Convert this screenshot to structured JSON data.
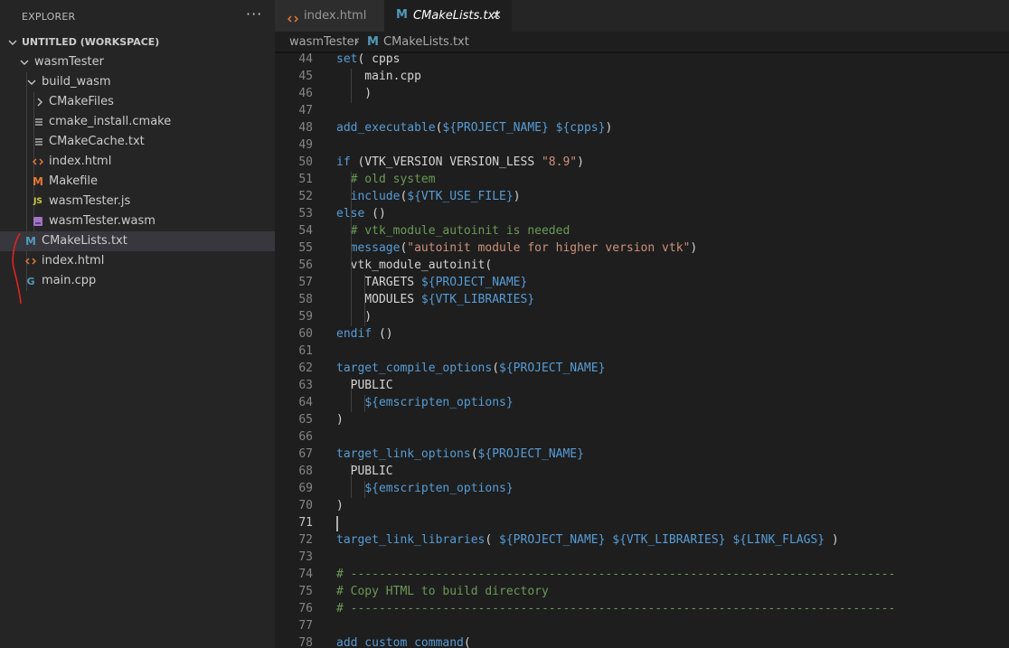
{
  "sidebar": {
    "title": "EXPLORER",
    "more": "···",
    "workspace": "UNTITLED (WORKSPACE)",
    "items": [
      {
        "label": "wasmTester",
        "kind": "folder-open"
      },
      {
        "label": "build_wasm",
        "kind": "folder-open"
      },
      {
        "label": "CMakeFiles",
        "kind": "folder-closed"
      },
      {
        "label": "cmake_install.cmake",
        "kind": "lines-icon"
      },
      {
        "label": "CMakeCache.txt",
        "kind": "lines-icon"
      },
      {
        "label": "index.html",
        "kind": "html-icon"
      },
      {
        "label": "Makefile",
        "kind": "makefile-icon"
      },
      {
        "label": "wasmTester.js",
        "kind": "js-icon"
      },
      {
        "label": "wasmTester.wasm",
        "kind": "wasm-icon"
      },
      {
        "label": "CMakeLists.txt",
        "kind": "cmake-icon",
        "selected": true
      },
      {
        "label": "index.html",
        "kind": "html-icon"
      },
      {
        "label": "main.cpp",
        "kind": "cpp-icon"
      }
    ],
    "js_glyph": "JS",
    "cmake_glyph": "M",
    "makefile_glyph": "M",
    "cpp_glyph": "G"
  },
  "tabs": [
    {
      "label": "index.html",
      "active": false
    },
    {
      "label": "CMakeLists.txt",
      "active": true,
      "close": "✕"
    }
  ],
  "breadcrumb": {
    "folder": "wasmTester",
    "sep": "›",
    "file": "CMakeLists.txt"
  },
  "editor": {
    "active_line": "71",
    "lines": [
      {
        "n": "44",
        "code": "set( cpps"
      },
      {
        "n": "45",
        "code": "    main.cpp"
      },
      {
        "n": "46",
        "code": "    )"
      },
      {
        "n": "47",
        "code": ""
      },
      {
        "n": "48",
        "code": "add_executable(${PROJECT_NAME} ${cpps})"
      },
      {
        "n": "49",
        "code": ""
      },
      {
        "n": "50",
        "code": "if (VTK_VERSION VERSION_LESS \"8.9\")"
      },
      {
        "n": "51",
        "code": "  # old system"
      },
      {
        "n": "52",
        "code": "  include(${VTK_USE_FILE})"
      },
      {
        "n": "53",
        "code": "else ()"
      },
      {
        "n": "54",
        "code": "  # vtk_module_autoinit is needed"
      },
      {
        "n": "55",
        "code": "  message(\"autoinit module for higher version vtk\")"
      },
      {
        "n": "56",
        "code": "  vtk_module_autoinit("
      },
      {
        "n": "57",
        "code": "    TARGETS ${PROJECT_NAME}"
      },
      {
        "n": "58",
        "code": "    MODULES ${VTK_LIBRARIES}"
      },
      {
        "n": "59",
        "code": "    )"
      },
      {
        "n": "60",
        "code": "endif ()"
      },
      {
        "n": "61",
        "code": ""
      },
      {
        "n": "62",
        "code": "target_compile_options(${PROJECT_NAME}"
      },
      {
        "n": "63",
        "code": "  PUBLIC"
      },
      {
        "n": "64",
        "code": "    ${emscripten_options}"
      },
      {
        "n": "65",
        "code": ")"
      },
      {
        "n": "66",
        "code": ""
      },
      {
        "n": "67",
        "code": "target_link_options(${PROJECT_NAME}"
      },
      {
        "n": "68",
        "code": "  PUBLIC"
      },
      {
        "n": "69",
        "code": "    ${emscripten_options}"
      },
      {
        "n": "70",
        "code": ")"
      },
      {
        "n": "71",
        "code": ""
      },
      {
        "n": "72",
        "code": "target_link_libraries( ${PROJECT_NAME} ${VTK_LIBRARIES} ${LINK_FLAGS} )"
      },
      {
        "n": "73",
        "code": ""
      },
      {
        "n": "74",
        "code": "# -----------------------------------------------------------------------------"
      },
      {
        "n": "75",
        "code": "# Copy HTML to build directory"
      },
      {
        "n": "76",
        "code": "# -----------------------------------------------------------------------------"
      },
      {
        "n": "77",
        "code": ""
      },
      {
        "n": "78",
        "code": "add_custom_command("
      }
    ]
  },
  "colors": {
    "sidebar_bg": "#252526",
    "editor_bg": "#1e1e1e",
    "selected_row": "#37373d",
    "keyword": "#569cd6",
    "string": "#ce9178",
    "comment": "#6a9955",
    "html_icon": "#e37933",
    "cmake_icon": "#519aba",
    "js_icon": "#cbcb41",
    "wasm_icon": "#a074c4",
    "annotation_red": "#e0231c"
  }
}
